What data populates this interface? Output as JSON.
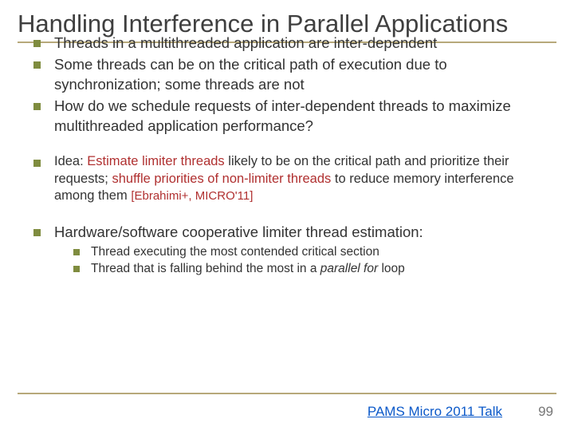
{
  "title": "Handling Interference in Parallel Applications",
  "bullets": {
    "b1": "Threads in a multithreaded application are inter-dependent",
    "b2": "Some threads can be on the critical path of execution due to synchronization; some threads are not",
    "b3": "How do we schedule requests of inter-dependent threads to maximize multithreaded application performance?"
  },
  "idea": {
    "prefix": "Idea: ",
    "kw1": "Estimate limiter threads",
    "mid1": " likely to be on the critical path and prioritize their requests; ",
    "kw2": "shuffle priorities of non-limiter threads",
    "mid2": " to reduce memory interference among them ",
    "cite": "[Ebrahimi+, MICRO'11]"
  },
  "hw": "Hardware/software cooperative limiter thread estimation:",
  "sub": {
    "s1": "Thread executing the most contended critical section",
    "s2a": "Thread that is falling behind the most in a ",
    "s2b": "parallel for",
    "s2c": " loop"
  },
  "footer_link": "PAMS Micro 2011 Talk",
  "page_number": "99"
}
